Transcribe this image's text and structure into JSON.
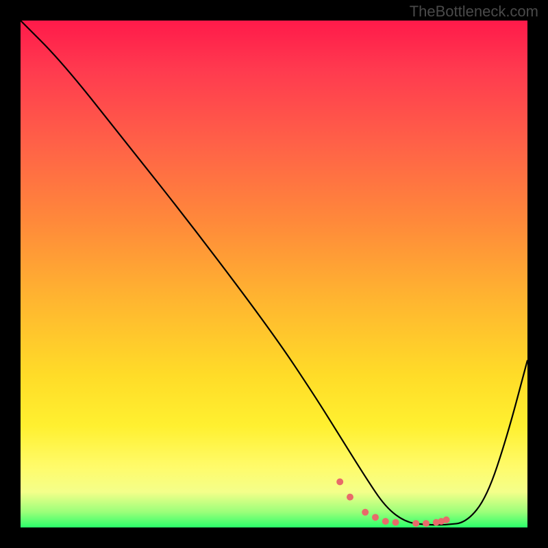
{
  "watermark": "TheBottleneck.com",
  "chart_data": {
    "type": "line",
    "title": "",
    "xlabel": "",
    "ylabel": "",
    "xlim": [
      0,
      100
    ],
    "ylim": [
      0,
      100
    ],
    "series": [
      {
        "name": "bottleneck-curve",
        "x": [
          0,
          8,
          20,
          35,
          50,
          58,
          63,
          68,
          72,
          76,
          80,
          84,
          88,
          92,
          96,
          100
        ],
        "values": [
          100,
          92,
          77,
          58,
          38,
          26,
          18,
          10,
          4,
          1,
          0.5,
          0.5,
          1,
          6,
          18,
          33
        ]
      }
    ],
    "markers": {
      "name": "sweet-spot-dots",
      "color": "#e86a6a",
      "x": [
        63,
        65,
        68,
        70,
        72,
        74,
        78,
        80,
        82,
        83,
        84
      ],
      "values": [
        9,
        6,
        3,
        2,
        1.2,
        1,
        0.8,
        0.8,
        1,
        1.2,
        1.5
      ]
    },
    "gradient_stops": [
      {
        "pos": 0,
        "color": "#ff1a4a"
      },
      {
        "pos": 25,
        "color": "#ff6347"
      },
      {
        "pos": 55,
        "color": "#ffb530"
      },
      {
        "pos": 80,
        "color": "#fff030"
      },
      {
        "pos": 97,
        "color": "#9aff7a"
      },
      {
        "pos": 100,
        "color": "#2aff6a"
      }
    ]
  }
}
